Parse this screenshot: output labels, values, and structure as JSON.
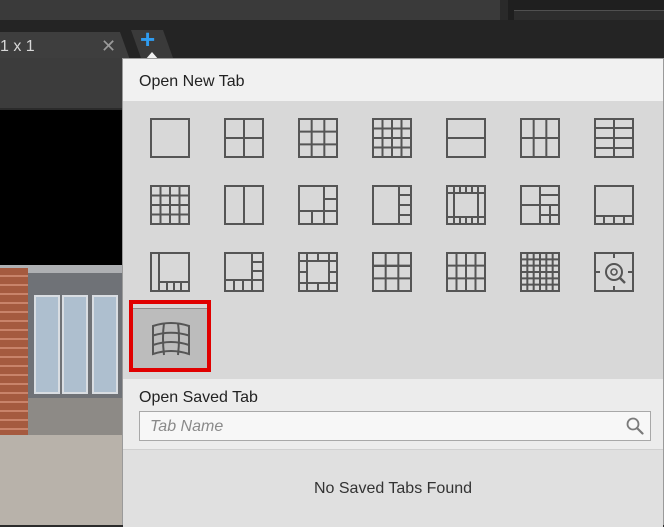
{
  "background": {
    "tab": {
      "label": "1 x 1",
      "close_glyph": "✕"
    },
    "add_tab_glyph": "+"
  },
  "popup": {
    "title": "Open New Tab",
    "layouts": [
      {
        "name": "layout-1x1-icon"
      },
      {
        "name": "layout-2x2-icon"
      },
      {
        "name": "layout-3x3-icon"
      },
      {
        "name": "layout-4x4-icon"
      },
      {
        "name": "layout-1-over-1-icon"
      },
      {
        "name": "layout-2-over-2-icon"
      },
      {
        "name": "layout-2-col-2-row-icon"
      },
      {
        "name": "layout-5x4-icon"
      },
      {
        "name": "layout-1x2-icon"
      },
      {
        "name": "layout-1-plus-5-icon"
      },
      {
        "name": "layout-1-plus-7-icon"
      },
      {
        "name": "layout-1-plus-12-icon"
      },
      {
        "name": "layout-1-plus-9-icon"
      },
      {
        "name": "layout-1-plus-4-bottom-icon"
      },
      {
        "name": "layout-1-plus-10-icon"
      },
      {
        "name": "layout-1-plus-11-icon"
      },
      {
        "name": "layout-1-plus-12-ring-icon"
      },
      {
        "name": "layout-2-plus-8-icon"
      },
      {
        "name": "layout-2-plus-9-icon"
      },
      {
        "name": "layout-6x6-icon"
      },
      {
        "name": "layout-fisheye-icon"
      },
      {
        "name": "layout-panoramic-warp-icon"
      }
    ],
    "selected_layout_index": 21,
    "saved": {
      "title": "Open Saved Tab",
      "search_placeholder": "Tab Name",
      "empty_message": "No Saved Tabs Found"
    }
  },
  "colors": {
    "accent_plus": "#2f9cf0",
    "highlight": "#e00000",
    "icon_stroke": "#555555"
  }
}
